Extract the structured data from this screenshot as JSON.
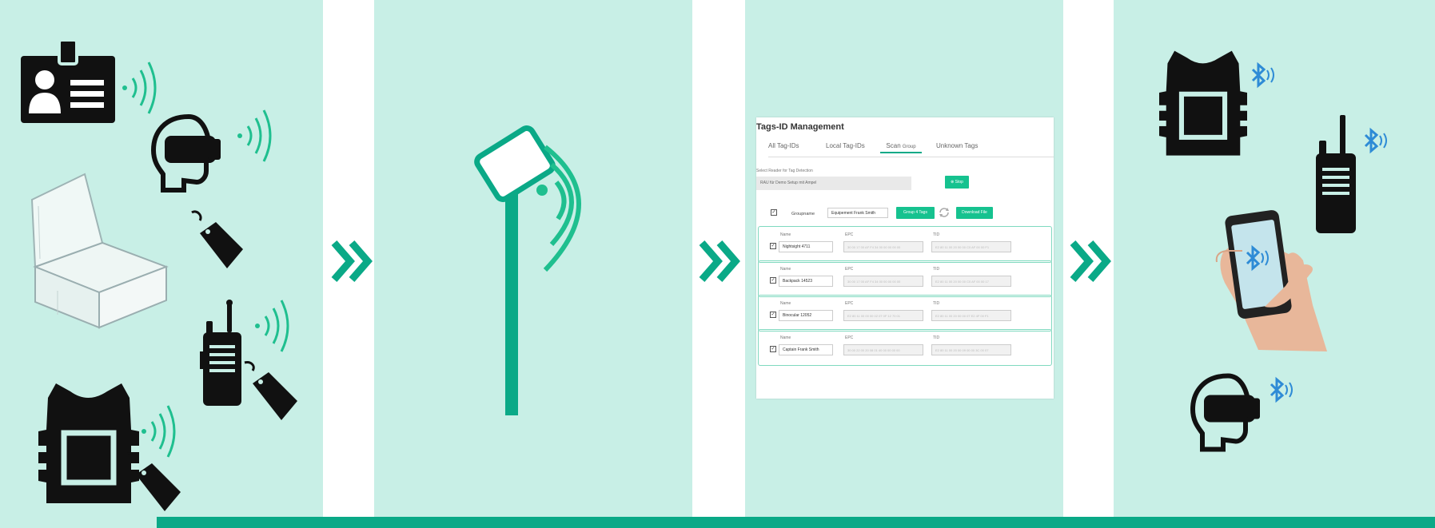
{
  "screen": {
    "title": "Tags-ID Management",
    "tabs": [
      {
        "label": "All Tag-IDs"
      },
      {
        "label": "Local Tag-IDs"
      },
      {
        "label": "Scan",
        "suffix": "Group"
      },
      {
        "label": "Unknown Tags"
      }
    ],
    "reader_label": "Select Reader for Tag Detection",
    "reader_value": "RAU für Demo Setup mit Ampel",
    "stop_button": "⊗ Stop",
    "groupname_label": "Groupname",
    "groupname_value": "Equipement Frank Smith",
    "group_button": "Group 4 Tags",
    "download_button": "Download File",
    "col_name": "Name",
    "col_epc": "EPC",
    "col_tid": "TID",
    "rows": [
      {
        "name": "Nightsight 4711",
        "epc": "30 00 17 00 AF F4 34 00 00 00 00 00",
        "tid": "E2 80 11 00 20 00 00 C0 AF 00 00 F1"
      },
      {
        "name": "Backpack 14523",
        "epc": "30 00 17 00 AF F4 34 00 00 00 00 00",
        "tid": "E2 80 11 00 20 00 00 C0 AF 00 00 17"
      },
      {
        "name": "Binocular 12052",
        "epc": "E2 80 11 00 00 00 02 07 0F 12 70 01",
        "tid": "E2 80 11 00 20 00 00 07 E2 4F 00 F1"
      },
      {
        "name": "Captain Frank Smith",
        "epc": "30 00 22 00 20 08 01 40 00 00 00 00",
        "tid": "E2 80 11 00 20 00 09 00 00 3C 00 07"
      }
    ]
  },
  "colors": {
    "panel": "#c8efe6",
    "accent": "#0aa987",
    "wave": "#1fbf8f",
    "bluetooth": "#2e8bd6",
    "icon": "#111111"
  },
  "icons": {
    "panel1": [
      "id-badge-icon",
      "vr-headset-icon",
      "plastic-box-icon",
      "tag-icon",
      "radio-icon",
      "vest-icon",
      "signal-waves-icon"
    ],
    "panel2": [
      "rfid-reader-antenna-icon"
    ],
    "panel4": [
      "vest-icon",
      "radio-icon",
      "smartphone-in-hand-icon",
      "vr-headset-icon",
      "bluetooth-icon"
    ],
    "arrows": "double-chevron-right-icon"
  }
}
